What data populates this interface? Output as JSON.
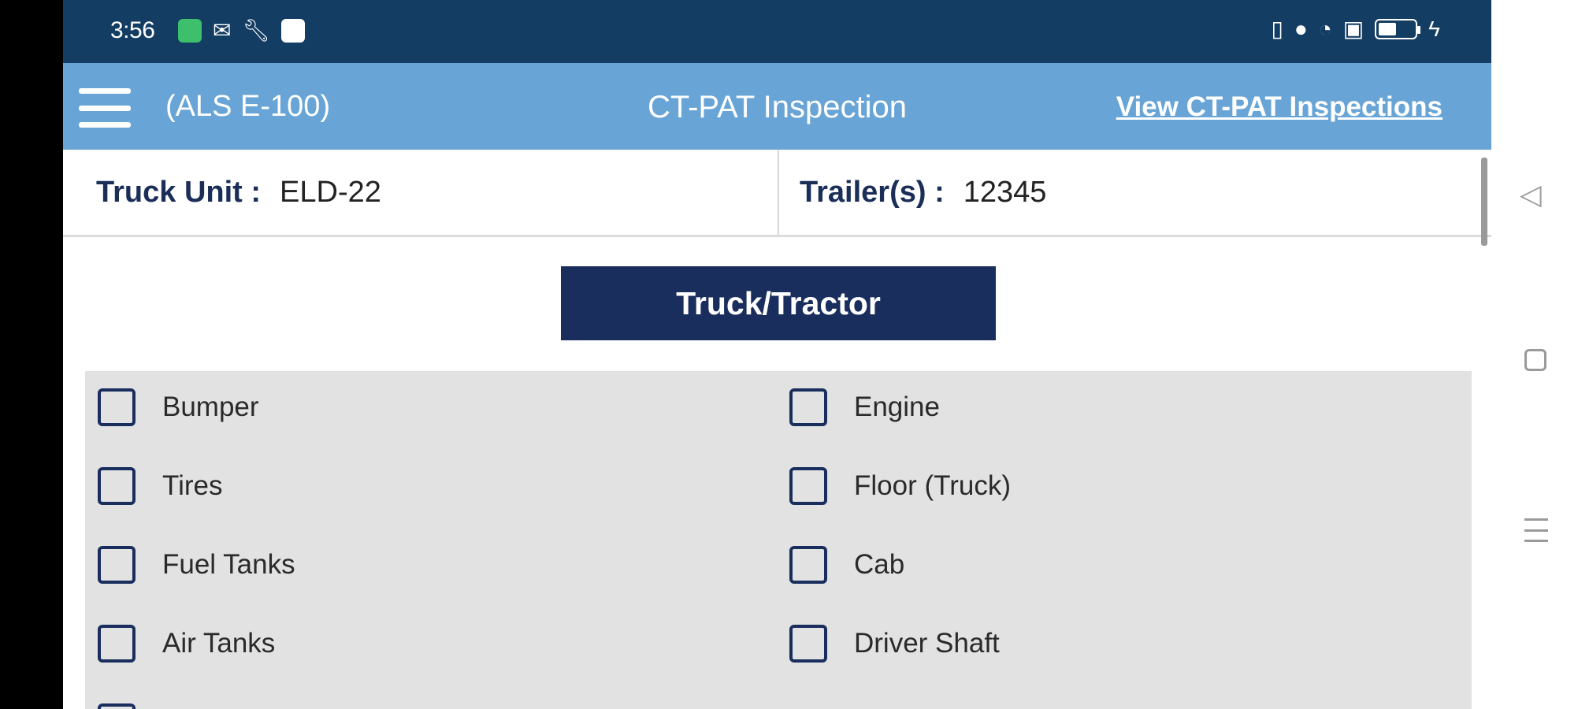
{
  "status_bar": {
    "time": "3:56",
    "left_icons": [
      "app-notification-icon",
      "gmail-icon",
      "wrench-icon",
      "message-icon"
    ],
    "right_icons": [
      "vibrate-icon",
      "location-icon",
      "wifi-icon",
      "no-sim-icon",
      "battery-icon",
      "charging-icon"
    ],
    "battery_level": "51",
    "battery_fraction": 0.51
  },
  "app_bar": {
    "menu_icon": "hamburger-menu-icon",
    "unit_code": "(ALS E-100)",
    "title": "CT-PAT Inspection",
    "view_link": "View CT-PAT Inspections"
  },
  "info": {
    "truck_label": "Truck Unit :",
    "truck_value": "ELD-22",
    "trailer_label": "Trailer(s) :",
    "trailer_value": "12345"
  },
  "section": {
    "label": "Truck/Tractor"
  },
  "checklist": {
    "left": [
      "Bumper",
      "Tires",
      "Fuel Tanks",
      "Air Tanks"
    ],
    "right": [
      "Engine",
      "Floor (Truck)",
      "Cab",
      "Driver Shaft"
    ]
  },
  "system_nav": {
    "icons": [
      "back-icon",
      "home-icon",
      "recent-apps-icon"
    ]
  },
  "colors": {
    "status_bar": "#133d63",
    "app_bar": "#68a5d6",
    "navy": "#1a2e5e",
    "checklist_bg": "#e2e2e2"
  }
}
